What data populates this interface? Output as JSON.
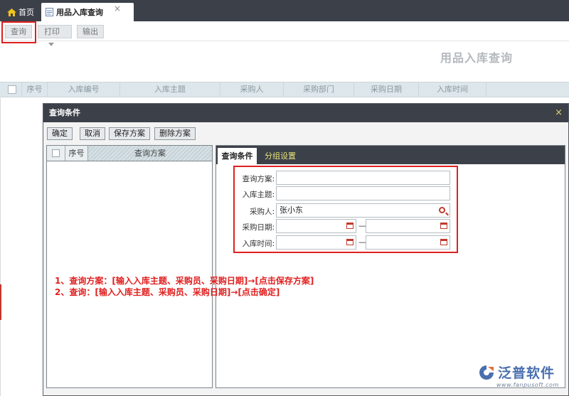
{
  "tabs": {
    "home": "首页",
    "active": "用品入库查询",
    "close": "×"
  },
  "toolbar": {
    "query": "查询",
    "print": "打印",
    "export": "输出"
  },
  "page_title": "用品入库查询",
  "grid": {
    "columns": [
      "序号",
      "入库编号",
      "入库主题",
      "采购人",
      "采购部门",
      "采购日期",
      "入库时间"
    ]
  },
  "modal": {
    "title": "查询条件",
    "close": "×",
    "buttons": {
      "confirm": "确定",
      "cancel": "取消",
      "save_plan": "保存方案",
      "delete_plan": "删除方案"
    },
    "plan_list": {
      "columns": [
        "序号",
        "查询方案"
      ]
    },
    "tabs": {
      "conditions": "查询条件",
      "grouping": "分组设置"
    },
    "form": {
      "plan_label": "查询方案:",
      "plan_value": "",
      "subject_label": "入库主题:",
      "subject_value": "",
      "buyer_label": "采购人:",
      "buyer_value": "张小东",
      "purchase_date_label": "采购日期:",
      "entry_time_label": "入库时间:",
      "range_dash": "—"
    },
    "notes": [
      "1、查询方案：[输入入库主题、采购员、采购日期]→[点击保存方案]",
      "2、查询：[输入入库主题、采购员、采购日期]→[点击确定]"
    ]
  },
  "logo": {
    "name": "泛普软件",
    "url": "www.fanpusoft.com"
  },
  "colors": {
    "dark_bar": "#3c4149",
    "highlight": "#e02020",
    "accent_yellow": "#e7e27a",
    "logo_blue": "#4a6fae"
  }
}
